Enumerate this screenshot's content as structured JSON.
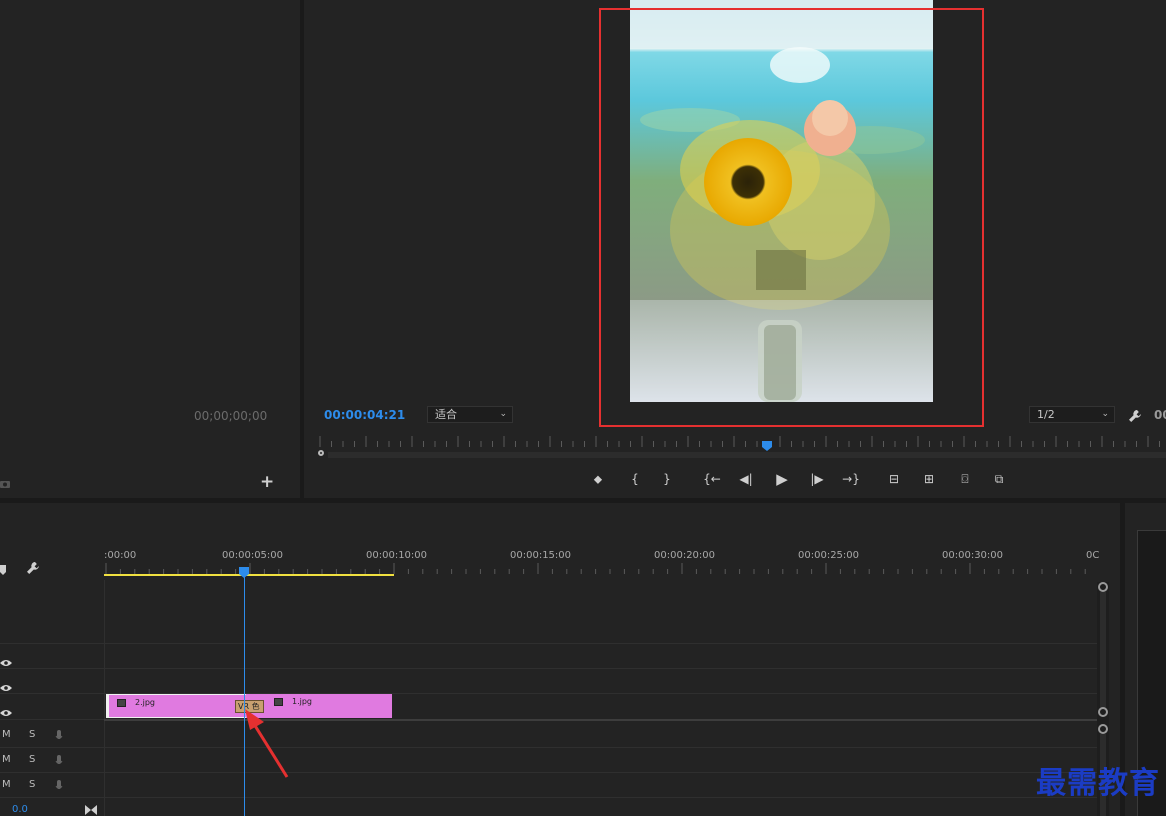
{
  "source_monitor": {
    "timecode": "00;00;00;00",
    "add_label": "+"
  },
  "program_monitor": {
    "timecode": "00:00:04:21",
    "fit_dropdown": "适合",
    "resolution_dropdown": "1/2",
    "right_timecode_partial": "00",
    "transport_icons": [
      "marker-icon",
      "mark-in-icon",
      "mark-out-icon",
      "go-to-in-icon",
      "step-back-icon",
      "play-icon",
      "step-forward-icon",
      "go-to-out-icon",
      "lift-icon",
      "extract-icon",
      "export-frame-icon",
      "compare-icon"
    ],
    "transport_glyphs": [
      "⬥",
      "{",
      "}",
      "{←",
      "◀|",
      "▶",
      "|▶",
      "→}",
      "⊟",
      "⊞",
      "⌼",
      "⧉"
    ],
    "playhead_progress": 0.53
  },
  "timeline": {
    "ruler_labels": [
      ":00:00",
      "00:00:05:00",
      "00:00:10:00",
      "00:00:15:00",
      "00:00:20:00",
      "00:00:25:00",
      "00:00:30:00",
      "0C"
    ],
    "clips": [
      {
        "name": "2.jpg"
      },
      {
        "name": "1.jpg"
      }
    ],
    "transition_label": "VR 色",
    "audio_tracks": [
      {
        "m": "M",
        "s": "S"
      },
      {
        "m": "M",
        "s": "S"
      },
      {
        "m": "M",
        "s": "S"
      }
    ],
    "master_value": "0.0"
  },
  "colors": {
    "accent_blue": "#2d8ceb",
    "clip_pink": "#e07ae0",
    "highlight_red": "#e53030",
    "work_area_yellow": "#f0e040"
  },
  "watermark": "最需教育"
}
